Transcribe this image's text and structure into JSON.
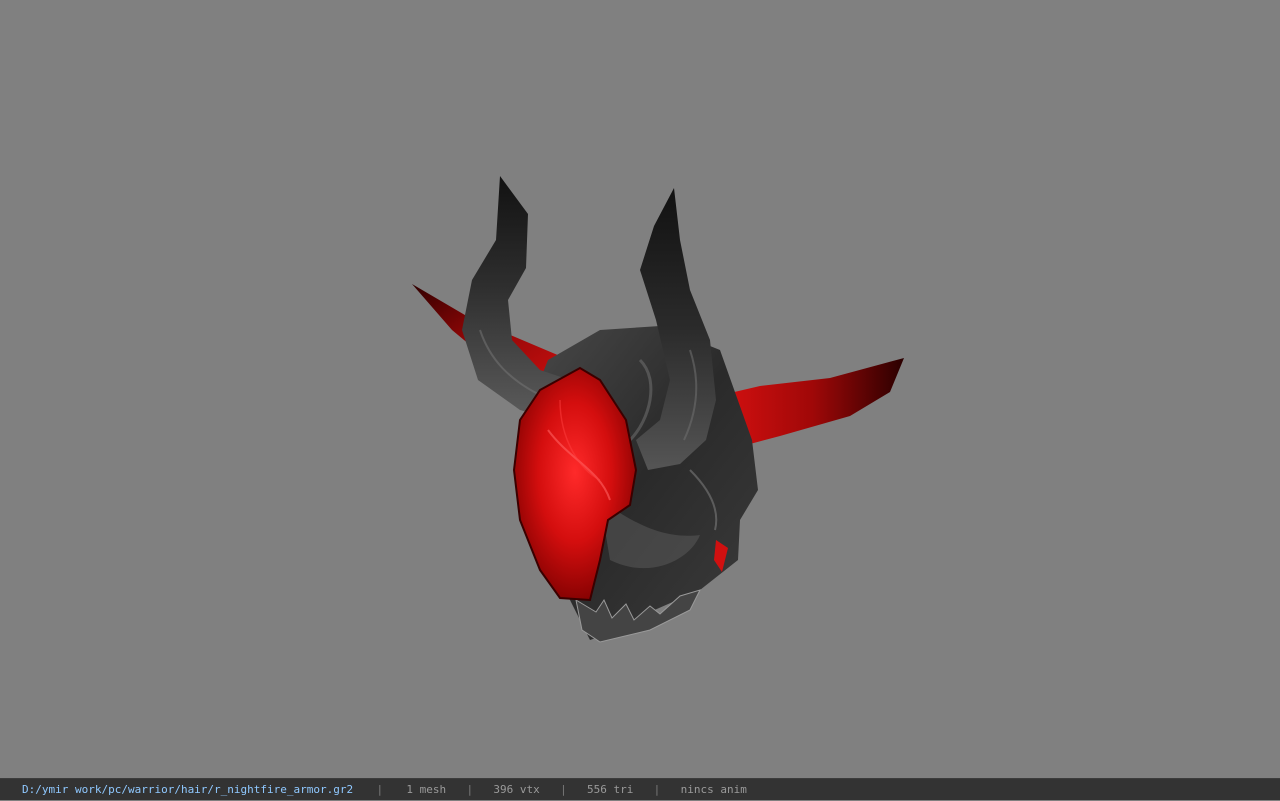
{
  "viewport": {
    "background_color": "#808080",
    "model": {
      "description_icon": "horned-helmet-model",
      "colors": {
        "horn": "#2b2b2b",
        "horn_highlight": "#5a5a5a",
        "accent_red": "#d81010",
        "accent_dark_red": "#5a0000",
        "shell": "#3a3a3a"
      }
    }
  },
  "statusbar": {
    "file_path": "D:/ymir work/pc/warrior/hair/r_nightfire_armor.gr2",
    "separator": "|",
    "mesh_count": "1 mesh",
    "vertex_count": "396 vtx",
    "triangle_count": "556 tri",
    "anim_status": "nincs anim",
    "colors": {
      "background": "#333333",
      "path_text": "#8fc8ff",
      "stat_text": "#9a9a9a"
    }
  }
}
